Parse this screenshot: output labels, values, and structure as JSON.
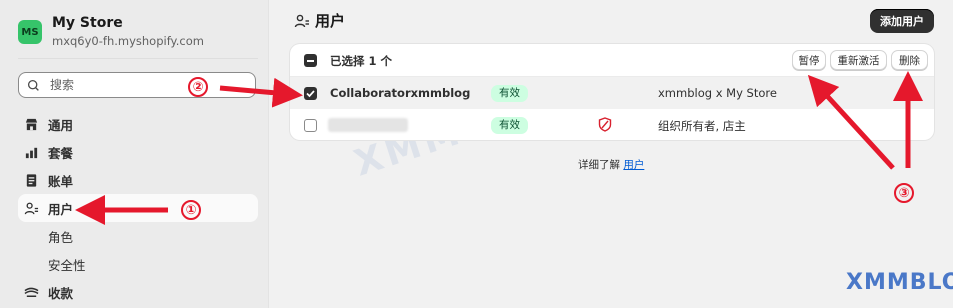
{
  "store": {
    "avatar": "MS",
    "name": "My Store",
    "domain": "mxq6y0-fh.myshopify.com",
    "avatar_color": "#36c46a"
  },
  "search": {
    "placeholder": "搜索"
  },
  "sidebar": {
    "items": [
      {
        "label": "通用",
        "icon": "store-icon"
      },
      {
        "label": "套餐",
        "icon": "plan-chart-icon"
      },
      {
        "label": "账单",
        "icon": "billing-icon"
      },
      {
        "label": "用户",
        "icon": "users-icon",
        "active": true
      },
      {
        "label": "角色",
        "sub": true
      },
      {
        "label": "安全性",
        "sub": true
      },
      {
        "label": "收款",
        "icon": "payments-icon"
      }
    ]
  },
  "page": {
    "title": "用户",
    "add_button": "添加用户"
  },
  "bulk": {
    "selected_text": "已选择 1 个",
    "suspend": "暂停",
    "reactivate": "重新激活",
    "delete": "删除"
  },
  "users": [
    {
      "name": "Collaboratorxmmblog",
      "status": "有效",
      "role": "xmmblog x My Store",
      "checked": true
    },
    {
      "name": "",
      "status": "有效",
      "role": "组织所有者, 店主",
      "checked": false,
      "owner_shield": true
    }
  ],
  "footer": {
    "learn_more": "详细了解",
    "link": "用户"
  },
  "annotations": {
    "n1": "①",
    "n2": "②",
    "n3": "③"
  },
  "watermark": "XMMBLOG",
  "colors": {
    "accent": "#303030",
    "badge_bg": "#cdfee1",
    "badge_text": "#0c5132",
    "link": "#005bd3",
    "arrow": "#e5182c"
  }
}
